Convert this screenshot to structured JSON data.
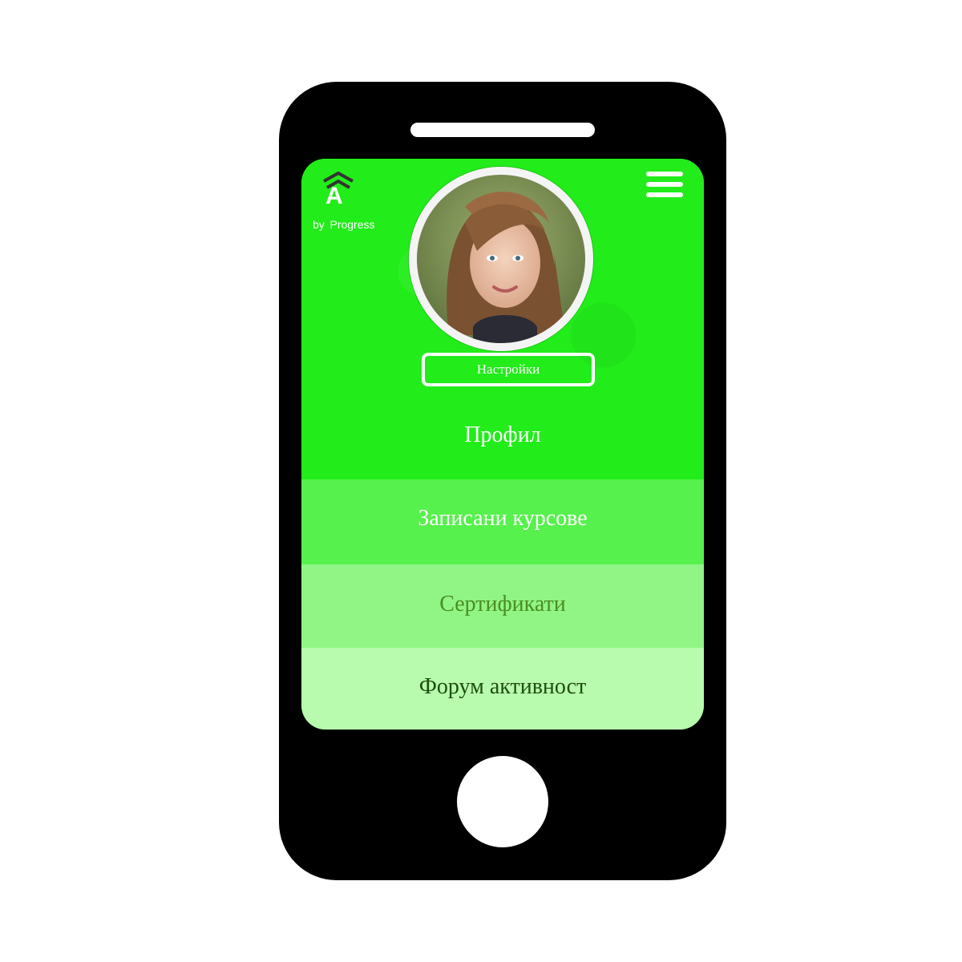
{
  "app": {
    "logo_letter": "A",
    "logo_tagline": "by  Progress"
  },
  "profile": {
    "settings_label": "Настройки"
  },
  "menu": {
    "items": [
      {
        "label": "Профил"
      },
      {
        "label": "Записани курсове"
      },
      {
        "label": "Сертификати"
      },
      {
        "label": "Форум активност"
      }
    ]
  },
  "colors": {
    "screen_green": "#22ee1c",
    "item_1_bg": "#56f14c",
    "item_2_bg": "#90f584",
    "item_3_bg": "#b8fbae",
    "phone_body": "#000000"
  },
  "icons": {
    "logo": "chevron-up-a-logo-icon",
    "menu": "hamburger-menu-icon"
  }
}
